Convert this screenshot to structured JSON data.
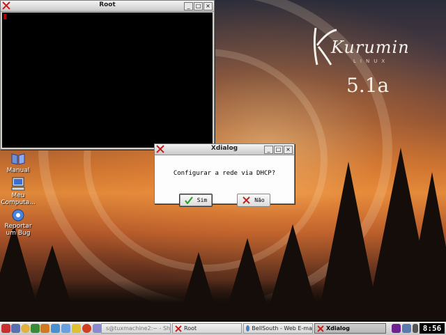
{
  "desktop": {
    "logo_text": "Kurumin",
    "logo_sub": "LINUX",
    "version": "5.1a",
    "icons": [
      {
        "label_line1": "Manual",
        "label_line2": ""
      },
      {
        "label_line1": "Meu",
        "label_line2": "Computa..."
      },
      {
        "label_line1": "Reportar",
        "label_line2": "um Bug"
      }
    ]
  },
  "terminal": {
    "title": "Root"
  },
  "dialog": {
    "title": "Xdialog",
    "message": "Configurar a rede via DHCP?",
    "yes_label": "Sim",
    "no_label": "Não"
  },
  "taskbar": {
    "tasks": [
      {
        "label": "s@tuxmachine2:~ - Sh"
      },
      {
        "label": "Root"
      },
      {
        "label": "BellSouth - Web E-ma"
      },
      {
        "label": "Xdialog"
      }
    ],
    "clock": "8:56"
  },
  "colors": {
    "accent_red": "#c81e1e",
    "check_green": "#2ea02e",
    "terminal_bg": "#000000",
    "window_frame": "#d4d0c8"
  }
}
